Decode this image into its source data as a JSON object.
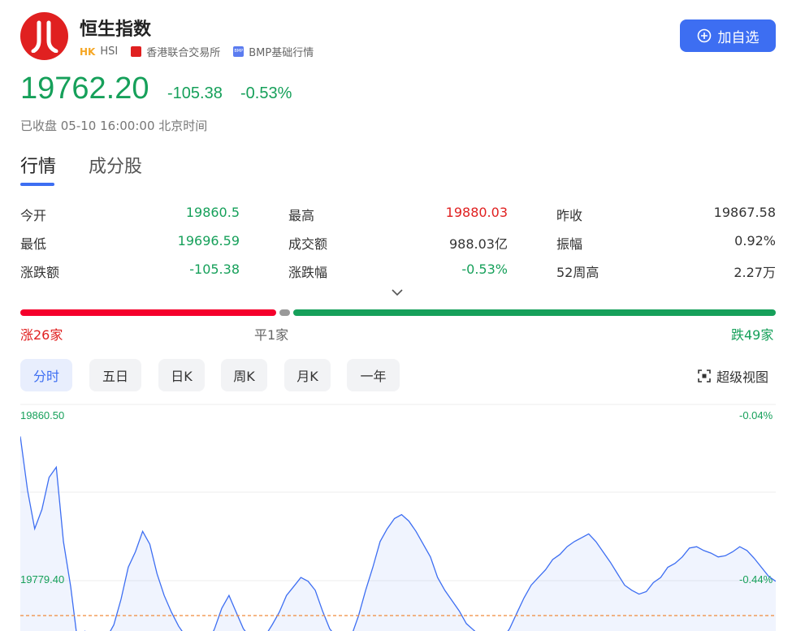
{
  "header": {
    "title": "恒生指数",
    "market": "HK",
    "code": "HSI",
    "exchange": "香港联合交易所",
    "quote_level": "BMP基础行情",
    "add_watch_label": "加自选"
  },
  "quote": {
    "price": "19762.20",
    "change": "-105.38",
    "change_pct": "-0.53%",
    "status": "已收盘 05-10 16:00:00 北京时间"
  },
  "tabs": [
    {
      "label": "行情",
      "active": true
    },
    {
      "label": "成分股",
      "active": false
    }
  ],
  "stats": [
    [
      {
        "label": "今开",
        "value": "19860.5"
      },
      {
        "label": "最高",
        "value": "19880.03"
      },
      {
        "label": "昨收",
        "value": "19867.58"
      }
    ],
    [
      {
        "label": "最低",
        "value": "19696.59"
      },
      {
        "label": "成交额",
        "value": "988.03亿"
      },
      {
        "label": "振幅",
        "value": "0.92%"
      }
    ],
    [
      {
        "label": "涨跌额",
        "value": "-105.38"
      },
      {
        "label": "涨跌幅",
        "value": "-0.53%"
      },
      {
        "label": "52周高",
        "value": "2.27万"
      }
    ]
  ],
  "breadth": {
    "up_label": "涨26家",
    "flat_label": "平1家",
    "down_label": "跌49家",
    "up": 26,
    "flat": 1,
    "down": 49,
    "up_color": "#f5002b",
    "flat_color": "#999999",
    "down_color": "#16a05a"
  },
  "periods": [
    {
      "label": "分时",
      "active": true
    },
    {
      "label": "五日",
      "active": false
    },
    {
      "label": "日K",
      "active": false
    },
    {
      "label": "周K",
      "active": false
    },
    {
      "label": "月K",
      "active": false
    },
    {
      "label": "一年",
      "active": false
    }
  ],
  "super_view_label": "超级视图",
  "icons": {
    "logo": "hang-seng-logo-icon",
    "add": "plus-circle-icon",
    "expand": "chevron-down-icon",
    "fullscreen": "fullscreen-icon"
  },
  "chart_data": {
    "type": "line",
    "y_tick_labels": [
      "19860.50",
      "19779.40"
    ],
    "pct_tick_labels": [
      "-0.04%",
      "-0.44%"
    ],
    "prev_close": 19867.58,
    "line_color": "#3d6ef2",
    "ref_line_color": "#f08a3c",
    "values": [
      19862,
      19820,
      19790,
      19805,
      19830,
      19838,
      19780,
      19745,
      19700,
      19710,
      19702,
      19698,
      19705,
      19715,
      19735,
      19760,
      19772,
      19788,
      19778,
      19755,
      19738,
      19725,
      19714,
      19706,
      19700,
      19698,
      19700,
      19712,
      19728,
      19738,
      19725,
      19712,
      19705,
      19702,
      19706,
      19715,
      19725,
      19738,
      19745,
      19752,
      19749,
      19742,
      19726,
      19712,
      19705,
      19700,
      19706,
      19722,
      19742,
      19760,
      19780,
      19790,
      19798,
      19801,
      19796,
      19788,
      19778,
      19768,
      19752,
      19742,
      19734,
      19726,
      19716,
      19711,
      19706,
      19702,
      19700,
      19704,
      19712,
      19724,
      19736,
      19746,
      19752,
      19758,
      19766,
      19770,
      19776,
      19780,
      19783,
      19786,
      19780,
      19772,
      19764,
      19755,
      19746,
      19742,
      19739,
      19741,
      19748,
      19752,
      19760,
      19763,
      19768,
      19775,
      19776,
      19773,
      19771,
      19768,
      19769,
      19772,
      19776,
      19773,
      19767,
      19760,
      19753,
      19749
    ]
  }
}
